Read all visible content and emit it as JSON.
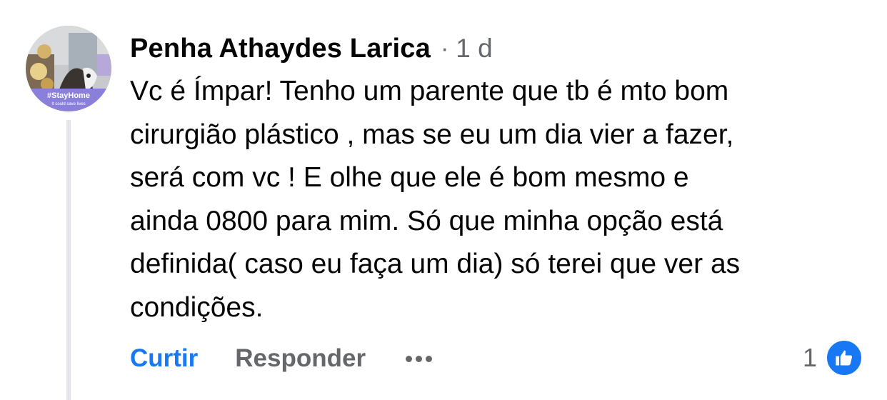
{
  "comment": {
    "author": "Penha Athaydes Larica",
    "separator": "·",
    "timestamp": "1 d",
    "text": "Vc é Ímpar! Tenho um parente que tb é mto bom\ncirurgião plástico , mas se eu um dia vier a fazer,\nserá com vc ! E olhe que  ele é bom mesmo e\nainda 0800 para mim. Só que minha opção  está\ndefinida( caso eu faça um dia) só terei que ver as\ncondições.",
    "avatar": {
      "badge_text": "#StayHome",
      "badge_subtext": "It could save lives",
      "frame_color": "#8b7fdc"
    }
  },
  "actions": {
    "like_label": "Curtir",
    "reply_label": "Responder",
    "more_icon": "more-horizontal-icon"
  },
  "reactions": {
    "count": "1",
    "icon": "thumbs-up-icon",
    "color": "#1877f2"
  }
}
